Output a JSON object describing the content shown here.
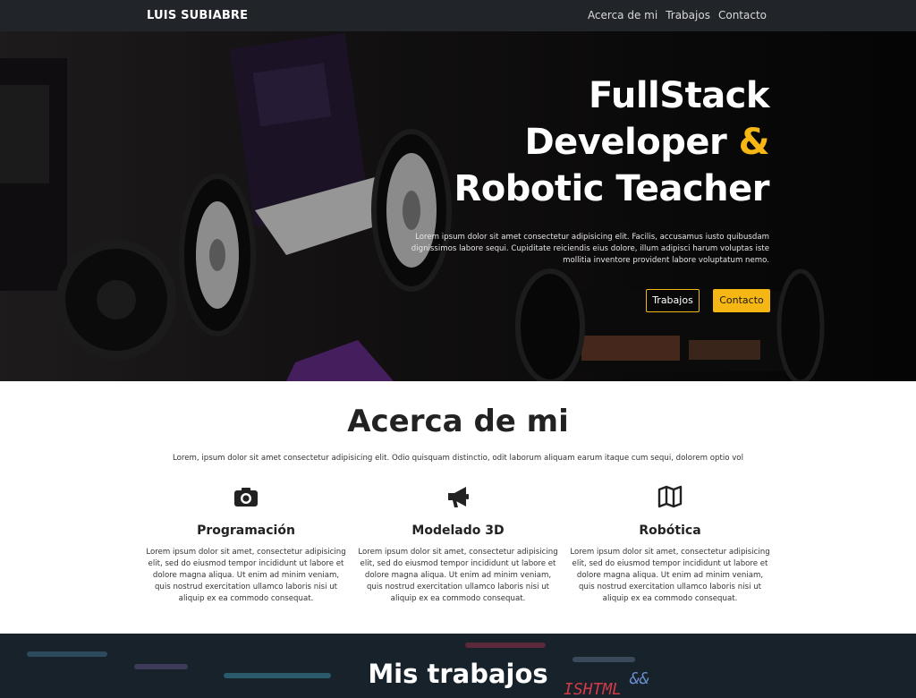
{
  "nav": {
    "brand": "LUIS SUBIABRE",
    "links": [
      "Acerca de mi",
      "Trabajos",
      "Contacto"
    ]
  },
  "hero": {
    "title_line1": "FullStack",
    "title_line2_a": "Developer ",
    "title_line2_amp": "&",
    "title_line3": "Robotic Teacher",
    "text": "Lorem ipsum dolor sit amet consectetur adipisicing elit. Facilis, accusamus iusto quibusdam dignissimos labore sequi. Cupiditate reiciendis eius dolore, illum adipisci harum voluptas iste mollitia inventore provident labore voluptatum nemo.",
    "btn_works": "Trabajos",
    "btn_contact": "Contacto"
  },
  "about": {
    "title": "Acerca de mi",
    "lead": "Lorem, ipsum dolor sit amet consectetur adipisicing elit. Odio quisquam distinctio, odit laborum aliquam earum itaque cum sequi, dolorem optio vol",
    "columns": [
      {
        "icon": "camera-icon",
        "title": "Programación",
        "text": "Lorem ipsum dolor sit amet, consectetur adipisicing elit, sed do eiusmod tempor incididunt ut labore et dolore magna aliqua. Ut enim ad minim veniam, quis nostrud exercitation ullamco laboris nisi ut aliquip ex ea commodo consequat."
      },
      {
        "icon": "megaphone-icon",
        "title": "Modelado 3D",
        "text": "Lorem ipsum dolor sit amet, consectetur adipisicing elit, sed do eiusmod tempor incididunt ut labore et dolore magna aliqua. Ut enim ad minim veniam, quis nostrud exercitation ullamco laboris nisi ut aliquip ex ea commodo consequat."
      },
      {
        "icon": "map-icon",
        "title": "Robótica",
        "text": "Lorem ipsum dolor sit amet, consectetur adipisicing elit, sed do eiusmod tempor incididunt ut labore et dolore magna aliqua. Ut enim ad minim veniam, quis nostrud exercitation ullamco laboris nisi ut aliquip ex ea commodo consequat."
      }
    ]
  },
  "works": {
    "title": "Mis trabajos",
    "bg_code": [
      "ISHTML",
      "&&"
    ]
  },
  "colors": {
    "accent": "#f6b613",
    "nav_bg": "#212529",
    "text_dark": "#222222"
  }
}
